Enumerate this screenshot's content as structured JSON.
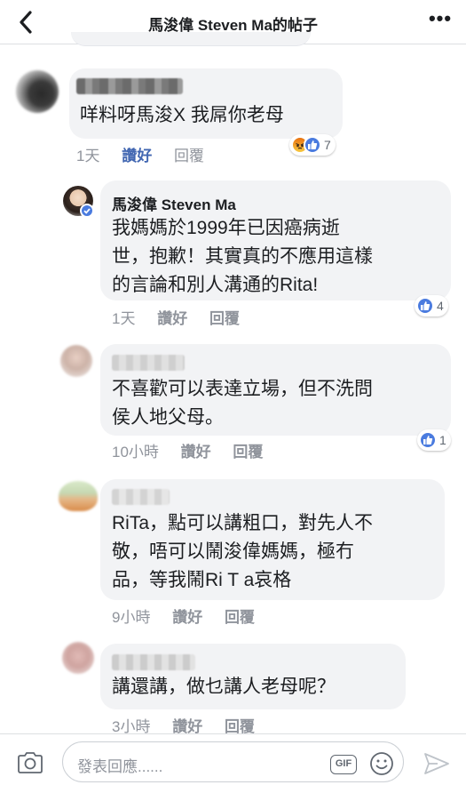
{
  "header": {
    "title": "馬浚偉 Steven Ma的帖子",
    "back_icon": "chevron-left-icon",
    "more_icon": "more-dots-icon",
    "more_label": "•••"
  },
  "comments": [
    {
      "author": "",
      "text_lines": [
        "咩料呀馬浚X 我屌你老母"
      ],
      "time": "1天",
      "like_label": "讚好",
      "liked": true,
      "reply_label": "回覆",
      "reactions": [
        "angry",
        "like"
      ],
      "reaction_count": "7"
    },
    {
      "author": "馬浚偉 Steven Ma",
      "verified": true,
      "text_lines": [
        "我媽媽於1999年已因癌病逝",
        "世，抱歉！其實真的不應用這樣",
        "的言論和別人溝通的Rita!"
      ],
      "time": "1天",
      "like_label": "讚好",
      "reply_label": "回覆",
      "reactions": [
        "like"
      ],
      "reaction_count": "4"
    },
    {
      "author": "",
      "text_lines": [
        "不喜歡可以表達立場，但不洗問",
        "侯人地父母。"
      ],
      "time": "10小時",
      "like_label": "讚好",
      "reply_label": "回覆",
      "reactions": [
        "like"
      ],
      "reaction_count": "1"
    },
    {
      "author": "",
      "text_lines": [
        "RiTa，點可以講粗口，對先人不",
        "敬，唔可以鬧浚偉媽媽，極冇",
        "品，等我鬧Ri T a哀格"
      ],
      "time": "9小時",
      "like_label": "讚好",
      "reply_label": "回覆"
    },
    {
      "author": "",
      "text_lines": [
        "講還講，做乜講人老母呢？"
      ],
      "time": "3小時",
      "like_label": "讚好",
      "reply_label": "回覆"
    }
  ],
  "composer": {
    "placeholder": "發表回應......",
    "gif_label": "GIF",
    "camera_icon": "camera-icon",
    "emoji_icon": "emoji-icon",
    "send_icon": "send-icon"
  },
  "colors": {
    "bubble": "#f2f3f5",
    "link_blue": "#4267b2",
    "meta_gray": "#90949c",
    "like_blue": "#4a7bdf"
  }
}
